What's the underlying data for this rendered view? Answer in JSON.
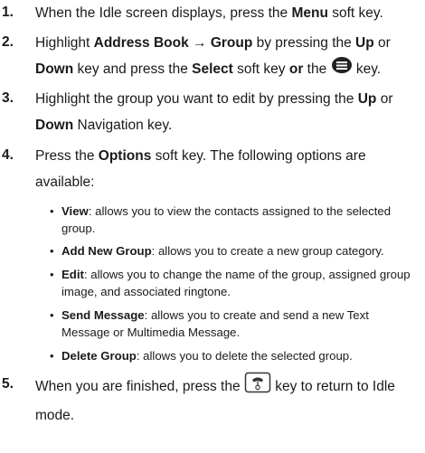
{
  "steps": [
    {
      "num": "1.",
      "parts": [
        "When the Idle screen displays, press the ",
        "Menu",
        " soft key."
      ]
    },
    {
      "num": "2.",
      "parts": [
        "Highlight ",
        "Address Book → Group",
        " by pressing the ",
        "Up",
        " or ",
        "Down",
        " key and press the ",
        "Select",
        " soft key ",
        "or",
        " the ",
        " key."
      ]
    },
    {
      "num": "3.",
      "parts": [
        "Highlight the group you want to edit by pressing the ",
        "Up",
        " or ",
        "Down",
        " Navigation key."
      ]
    },
    {
      "num": "4.",
      "parts": [
        "Press the ",
        "Options",
        " soft key. The following options are available:"
      ]
    },
    {
      "num": "5.",
      "parts": [
        "When you are finished, press the ",
        " key to return to Idle mode."
      ]
    }
  ],
  "options": [
    {
      "term": "View",
      "desc": ": allows you to view the contacts assigned to the selected group."
    },
    {
      "term": "Add New Group",
      "desc": ": allows you to create a new group category."
    },
    {
      "term": "Edit",
      "desc": ": allows you to change the name of the group, assigned group image, and associated ringtone."
    },
    {
      "term": "Send Message",
      "desc": ": allows you to create and send a new Text Message or Multimedia Message."
    },
    {
      "term": "Delete Group",
      "desc": ": allows you to delete the selected group."
    }
  ],
  "bullet_glyph": "•",
  "icons": {
    "step2": "menu-ok-key-icon",
    "step5": "end-power-key-icon"
  }
}
